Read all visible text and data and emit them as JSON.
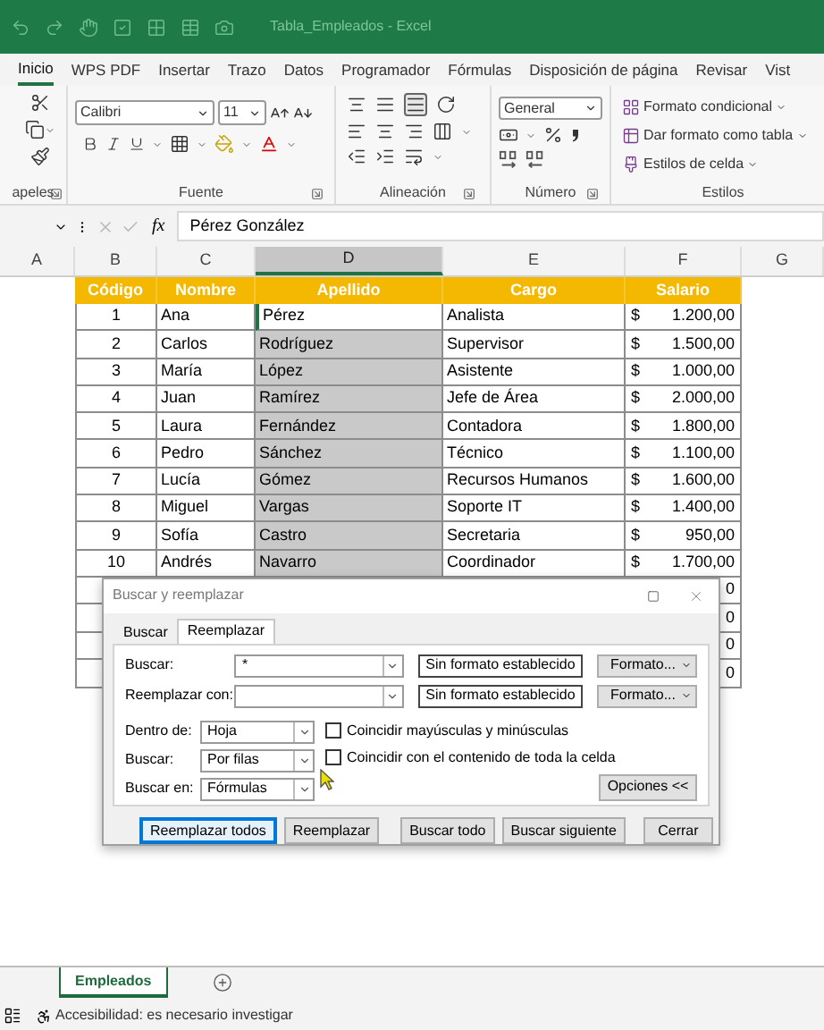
{
  "window": {
    "title": "Tabla_Empleados - Excel"
  },
  "ribbon_tabs": [
    {
      "label": "Inicio",
      "selected": true
    },
    {
      "label": "WPS PDF",
      "selected": false
    },
    {
      "label": "Insertar",
      "selected": false
    },
    {
      "label": "Trazo",
      "selected": false
    },
    {
      "label": "Datos",
      "selected": false
    },
    {
      "label": "Programador",
      "selected": false
    },
    {
      "label": "Fórmulas",
      "selected": false
    },
    {
      "label": "Disposición de página",
      "selected": false
    },
    {
      "label": "Revisar",
      "selected": false
    },
    {
      "label": "Vist",
      "selected": false
    }
  ],
  "ribbon": {
    "clipboard": {
      "label": "apeles"
    },
    "font": {
      "label": "Fuente",
      "font_name": "Calibri",
      "font_size": "11"
    },
    "alignment": {
      "label": "Alineación"
    },
    "number": {
      "label": "Número",
      "format": "General"
    },
    "styles": {
      "label": "Estilos",
      "buttons": [
        "Formato condicional",
        "Dar formato como tabla",
        "Estilos de celda"
      ]
    }
  },
  "formula_bar": {
    "fx": "fx",
    "value": "Pérez González"
  },
  "columns": [
    {
      "label": "A",
      "selected": false
    },
    {
      "label": "B",
      "selected": false
    },
    {
      "label": "C",
      "selected": false
    },
    {
      "label": "D",
      "selected": true
    },
    {
      "label": "E",
      "selected": false
    },
    {
      "label": "F",
      "selected": false
    },
    {
      "label": "G",
      "selected": false
    }
  ],
  "table": {
    "headers": [
      "Código",
      "Nombre",
      "Apellido",
      "Cargo",
      "Salario"
    ],
    "rows": [
      {
        "codigo": "1",
        "nombre": "Ana",
        "apellido": "Pérez",
        "cargo": "Analista",
        "moneda": "$",
        "salario": "1.200,00",
        "active": true
      },
      {
        "codigo": "2",
        "nombre": "Carlos",
        "apellido": "Rodríguez",
        "cargo": "Supervisor",
        "moneda": "$",
        "salario": "1.500,00",
        "active": false
      },
      {
        "codigo": "3",
        "nombre": "María",
        "apellido": "López",
        "cargo": "Asistente",
        "moneda": "$",
        "salario": "1.000,00",
        "active": false
      },
      {
        "codigo": "4",
        "nombre": "Juan",
        "apellido": "Ramírez",
        "cargo": "Jefe de Área",
        "moneda": "$",
        "salario": "2.000,00",
        "active": false
      },
      {
        "codigo": "5",
        "nombre": "Laura",
        "apellido": "Fernández",
        "cargo": "Contadora",
        "moneda": "$",
        "salario": "1.800,00",
        "active": false
      },
      {
        "codigo": "6",
        "nombre": "Pedro",
        "apellido": "Sánchez",
        "cargo": "Técnico",
        "moneda": "$",
        "salario": "1.100,00",
        "active": false
      },
      {
        "codigo": "7",
        "nombre": "Lucía",
        "apellido": "Gómez",
        "cargo": "Recursos Humanos",
        "moneda": "$",
        "salario": "1.600,00",
        "active": false
      },
      {
        "codigo": "8",
        "nombre": "Miguel",
        "apellido": "Vargas",
        "cargo": "Soporte IT",
        "moneda": "$",
        "salario": "1.400,00",
        "active": false
      },
      {
        "codigo": "9",
        "nombre": "Sofía",
        "apellido": "Castro",
        "cargo": "Secretaria",
        "moneda": "$",
        "salario": "950,00",
        "active": false
      },
      {
        "codigo": "10",
        "nombre": "Andrés",
        "apellido": "Navarro",
        "cargo": "Coordinador",
        "moneda": "$",
        "salario": "1.700,00",
        "active": false
      }
    ],
    "partial_rows": [
      {
        "salario": "0"
      },
      {
        "salario": "0"
      },
      {
        "salario": "0"
      },
      {
        "salario": "0"
      }
    ]
  },
  "dialog": {
    "title": "Buscar y reemplazar",
    "tabs": [
      {
        "label": "Buscar",
        "selected": false
      },
      {
        "label": "Reemplazar",
        "selected": true
      }
    ],
    "fields": [
      {
        "label": "Buscar:",
        "value": "*",
        "format_status": "Sin formato establecido",
        "format_button": "Formato..."
      },
      {
        "label": "Reemplazar con:",
        "format_status": "Sin formato establecido",
        "format_button": "Formato..."
      }
    ],
    "options": [
      {
        "label": "Dentro de:",
        "value": "Hoja"
      },
      {
        "label": "Buscar:",
        "value": "Por filas"
      },
      {
        "label": "Buscar en:",
        "value": "Fórmulas"
      }
    ],
    "checkboxes": [
      {
        "label": "Coincidir mayúsculas y minúsculas",
        "checked": false
      },
      {
        "label": "Coincidir con el contenido de toda la celda",
        "checked": false
      }
    ],
    "options_button": "Opciones <<",
    "buttons": [
      {
        "label": "Reemplazar todos",
        "focused": true
      },
      {
        "label": "Reemplazar",
        "focused": false
      },
      {
        "label": "Buscar todo",
        "focused": false
      },
      {
        "label": "Buscar siguiente",
        "focused": false
      },
      {
        "label": "Cerrar",
        "focused": false
      }
    ]
  },
  "sheet_tabs": [
    {
      "label": "Empleados",
      "selected": true
    }
  ],
  "status_bar": {
    "text": "Accesibilidad: es necesario investigar"
  }
}
